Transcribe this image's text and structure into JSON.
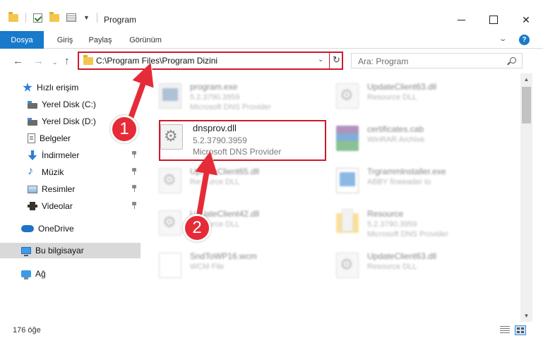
{
  "window": {
    "title": "Program",
    "controls": {
      "minimize": "",
      "maximize": "",
      "close": "✕"
    }
  },
  "ribbon": {
    "tabs": [
      {
        "label": "Dosya",
        "active": true
      },
      {
        "label": "Giriş"
      },
      {
        "label": "Paylaş"
      },
      {
        "label": "Görünüm"
      }
    ],
    "help": "?"
  },
  "navigation": {
    "back": "←",
    "forward": "→",
    "recent": "⌄",
    "up": "↑",
    "address": "C:\\Program Files\\Program Dizini",
    "address_dropdown": "⌄",
    "refresh": "↻",
    "search_placeholder": "Ara: Program"
  },
  "sidebar": {
    "items": [
      {
        "label": "Hızlı erişim",
        "icon": "star-icon"
      },
      {
        "label": "Yerel Disk (C:)",
        "icon": "disk-icon"
      },
      {
        "label": "Yerel Disk (D:)",
        "icon": "disk-icon"
      },
      {
        "label": "Belgeler",
        "icon": "document-icon"
      },
      {
        "label": "İndirmeler",
        "icon": "download-icon",
        "pinned": true
      },
      {
        "label": "Müzik",
        "icon": "music-icon",
        "pinned": true
      },
      {
        "label": "Resimler",
        "icon": "pictures-icon",
        "pinned": true
      },
      {
        "label": "Videolar",
        "icon": "video-icon",
        "pinned": true
      },
      {
        "label": "OneDrive",
        "icon": "onedrive-icon"
      },
      {
        "label": "Bu bilgisayar",
        "icon": "pc-icon",
        "selected": true
      },
      {
        "label": "Ağ",
        "icon": "network-icon"
      }
    ]
  },
  "files": [
    {
      "name": "program.exe",
      "line2": "5.2.3790.3959",
      "line3": "Microsoft DNS Provider",
      "icon": "exe-icon",
      "blurred": true
    },
    {
      "name": "UpdateClient63.dll",
      "line2": "Resource DLL",
      "line3": "",
      "icon": "dll-icon",
      "blurred": true
    },
    {
      "name": "dnsprov.dll",
      "line2": "5.2.3790.3959",
      "line3": "Microsoft DNS Provider",
      "icon": "dll-icon",
      "highlighted": true
    },
    {
      "name": "certificates.cab",
      "line2": "WinRAR Archive",
      "line3": "",
      "icon": "cab-icon",
      "blurred": true
    },
    {
      "name": "UpdateClient65.dll",
      "line2": "Resource DLL",
      "line3": "",
      "icon": "dll-icon",
      "blurred": true
    },
    {
      "name": "Trgrammlnstaller.exe",
      "line2": "ABBY fineeader to",
      "line3": "",
      "icon": "installer-icon",
      "blurred": true
    },
    {
      "name": "UpdateClient42.dll",
      "line2": "Resource DLL",
      "line3": "",
      "icon": "dll-icon",
      "blurred": true
    },
    {
      "name": "Resource",
      "line2": "5.2.3790.3959",
      "line3": "Microsoft DNS Provider",
      "icon": "folder-icon",
      "blurred": true
    },
    {
      "name": "SndToWP16.wcm",
      "line2": "WCM File",
      "line3": "",
      "icon": "file-icon",
      "blurred": true
    },
    {
      "name": "UpdateClient63.dll",
      "line2": "Resource DLL",
      "line3": "",
      "icon": "dll-icon",
      "blurred": true
    }
  ],
  "scrollbar": {
    "up": "▲",
    "down": "▼"
  },
  "status": {
    "count": "176 öğe"
  },
  "annotations": {
    "step1": "1",
    "step2": "2"
  },
  "colors": {
    "accent": "#1979ca",
    "annotation": "#e52b38",
    "highlight_border": "#d0182b"
  }
}
